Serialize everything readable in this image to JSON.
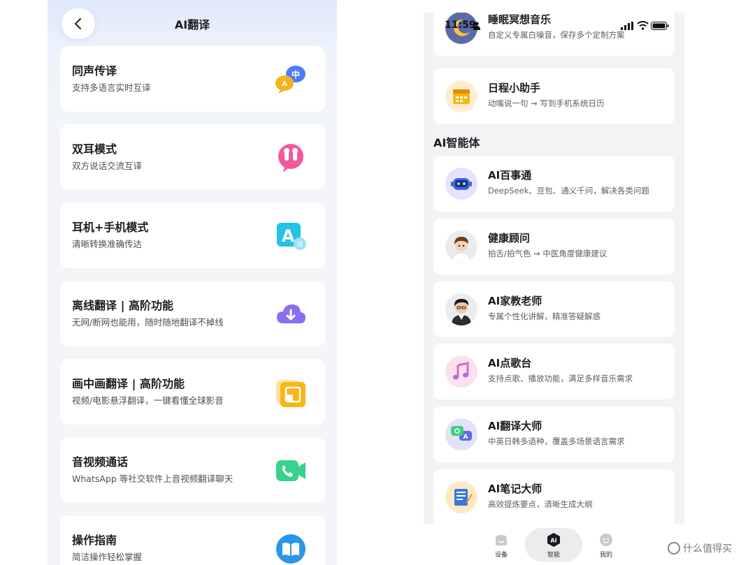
{
  "left": {
    "title": "AI翻译",
    "items": [
      {
        "title": "同声传译",
        "subtitle": "支持多语言实时互译",
        "icon": "simultaneous-translate-icon"
      },
      {
        "title": "双耳模式",
        "subtitle": "双方说话交流互译",
        "icon": "earbuds-icon"
      },
      {
        "title": "耳机+手机模式",
        "subtitle": "清晰转换准确传达",
        "icon": "translate-a-icon"
      },
      {
        "title": "离线翻译 | 高阶功能",
        "subtitle": "无网/断网也能用，随时随地翻译不掉线",
        "icon": "cloud-download-icon"
      },
      {
        "title": "画中画翻译 | 高阶功能",
        "subtitle": "视频/电影悬浮翻译，一键看懂全球影音",
        "icon": "pip-icon"
      },
      {
        "title": "音视频通话",
        "subtitle": "WhatsApp 等社交软件上音视频翻译聊天",
        "icon": "video-call-icon"
      },
      {
        "title": "操作指南",
        "subtitle": "简洁操作轻松掌握",
        "icon": "guide-book-icon"
      }
    ]
  },
  "right": {
    "status": {
      "time": "11:59"
    },
    "top_items": [
      {
        "title": "睡眠冥想音乐",
        "subtitle": "自定义专属白噪音，保存多个定制方案",
        "icon": "moon-icon"
      },
      {
        "title": "日程小助手",
        "subtitle": "动嘴说一句 → 写到手机系统日历",
        "icon": "calendar-icon"
      }
    ],
    "section_title": "AI智能体",
    "agents": [
      {
        "title": "AI百事通",
        "subtitle": "DeepSeek、豆包、通义千问，解决各类问题",
        "icon": "robot-icon"
      },
      {
        "title": "健康顾问",
        "subtitle": "拍舌/拍气色 → 中医角度健康建议",
        "icon": "doctor-avatar-icon"
      },
      {
        "title": "AI家教老师",
        "subtitle": "专属个性化讲解，精准答疑解惑",
        "icon": "teacher-avatar-icon"
      },
      {
        "title": "AI点歌台",
        "subtitle": "支持点歌、播放功能，满足多样音乐需求",
        "icon": "music-note-icon"
      },
      {
        "title": "AI翻译大师",
        "subtitle": "中英日韩多语种，覆盖多场景语言需求",
        "icon": "translate-bubble-icon"
      },
      {
        "title": "AI笔记大师",
        "subtitle": "高效提炼要点，清晰生成大纲",
        "icon": "notebook-icon"
      }
    ],
    "tabs": [
      {
        "label": "设备",
        "icon": "device-icon"
      },
      {
        "label": "智能",
        "icon": "ai-hexagon-icon",
        "active": true
      },
      {
        "label": "我的",
        "icon": "profile-icon"
      }
    ]
  },
  "watermark": {
    "text": "什么值得买"
  },
  "colors": {
    "accent_blue": "#4f7cf7",
    "card_bg": "#ffffff",
    "page_bg": "#f3f3f5"
  }
}
